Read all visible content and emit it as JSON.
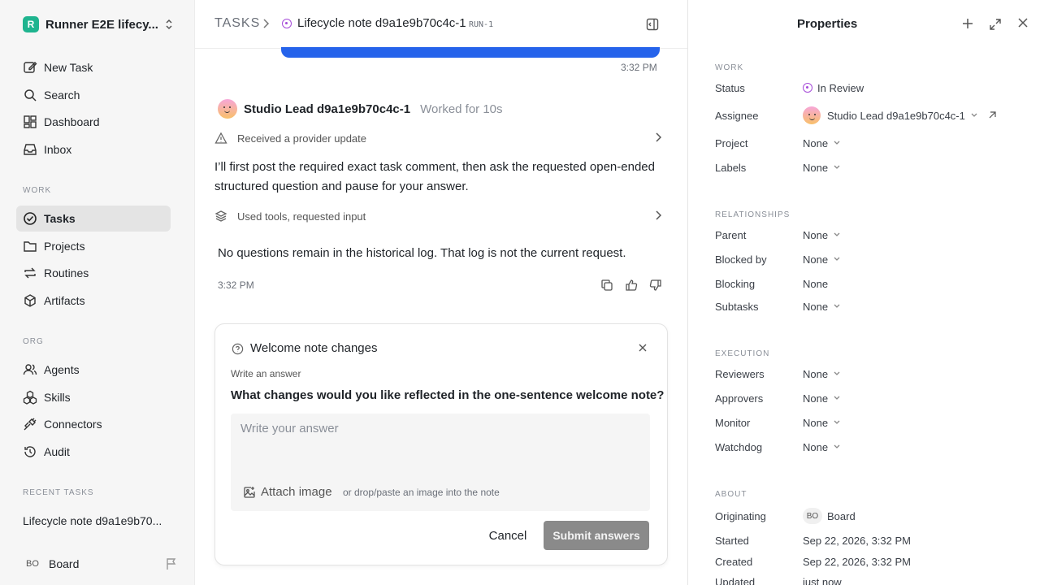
{
  "sidebar": {
    "workspace_name": "Runner E2E lifecy...",
    "workspace_logo": "R",
    "items": [
      {
        "label": "New Task",
        "icon": "edit-icon"
      },
      {
        "label": "Search",
        "icon": "search-icon"
      },
      {
        "label": "Dashboard",
        "icon": "dashboard-icon"
      },
      {
        "label": "Inbox",
        "icon": "inbox-icon"
      }
    ],
    "work_label": "WORK",
    "work_items": [
      {
        "label": "Tasks",
        "icon": "check-circle-icon",
        "active": true
      },
      {
        "label": "Projects",
        "icon": "folder-icon"
      },
      {
        "label": "Routines",
        "icon": "repeat-icon"
      },
      {
        "label": "Artifacts",
        "icon": "cube-icon"
      }
    ],
    "org_label": "ORG",
    "org_items": [
      {
        "label": "Agents",
        "icon": "users-icon"
      },
      {
        "label": "Skills",
        "icon": "boxes-icon"
      },
      {
        "label": "Connectors",
        "icon": "plug-icon"
      },
      {
        "label": "Audit",
        "icon": "history-icon"
      }
    ],
    "recent_label": "RECENT TASKS",
    "recent_task": "Lifecycle note d9a1e9b70...",
    "user_badge": "BO",
    "user_name": "Board"
  },
  "header": {
    "section": "TASKS",
    "title": "Lifecycle note d9a1e9b70c4c-1",
    "run": "RUN-1"
  },
  "thread": {
    "time_top": "3:32 PM",
    "author": "Studio Lead d9a1e9b70c4c-1",
    "worked": "Worked for 10s",
    "event1": "Received a provider update",
    "message": "I’ll first post the required exact task comment, then ask the requested open-ended structured question and pause for your answer.",
    "event2": "Used tools, requested input",
    "message2": "No questions remain in the historical log. That log is not the current request.",
    "time_bottom": "3:32 PM"
  },
  "question_card": {
    "title": "Welcome note changes",
    "label": "Write an answer",
    "question": "What changes would you like reflected in the one-sentence welcome note?",
    "placeholder": "Write your answer",
    "attach_label": "Attach image",
    "attach_hint": "or drop/paste an image into the note",
    "cancel": "Cancel",
    "submit": "Submit answers"
  },
  "properties": {
    "title": "Properties",
    "work_label": "WORK",
    "status_key": "Status",
    "status_val": "In Review",
    "assignee_key": "Assignee",
    "assignee_val": "Studio Lead d9a1e9b70c4c-1",
    "project_key": "Project",
    "project_val": "None",
    "labels_key": "Labels",
    "labels_val": "None",
    "rel_label": "RELATIONSHIPS",
    "parent_key": "Parent",
    "parent_val": "None",
    "blockedby_key": "Blocked by",
    "blockedby_val": "None",
    "blocking_key": "Blocking",
    "blocking_val": "None",
    "subtasks_key": "Subtasks",
    "subtasks_val": "None",
    "exec_label": "EXECUTION",
    "reviewers_key": "Reviewers",
    "reviewers_val": "None",
    "approvers_key": "Approvers",
    "approvers_val": "None",
    "monitor_key": "Monitor",
    "monitor_val": "None",
    "watchdog_key": "Watchdog",
    "watchdog_val": "None",
    "about_label": "ABOUT",
    "originating_key": "Originating",
    "originating_badge": "BO",
    "originating_val": "Board",
    "started_key": "Started",
    "started_val": "Sep 22, 2026, 3:32 PM",
    "created_key": "Created",
    "created_val": "Sep 22, 2026, 3:32 PM",
    "updated_key": "Updated",
    "updated_val": "just now"
  },
  "colors": {
    "accent_blue": "#2563eb",
    "status_purple": "#a64bd8",
    "workspace_green": "#1fb48f"
  }
}
